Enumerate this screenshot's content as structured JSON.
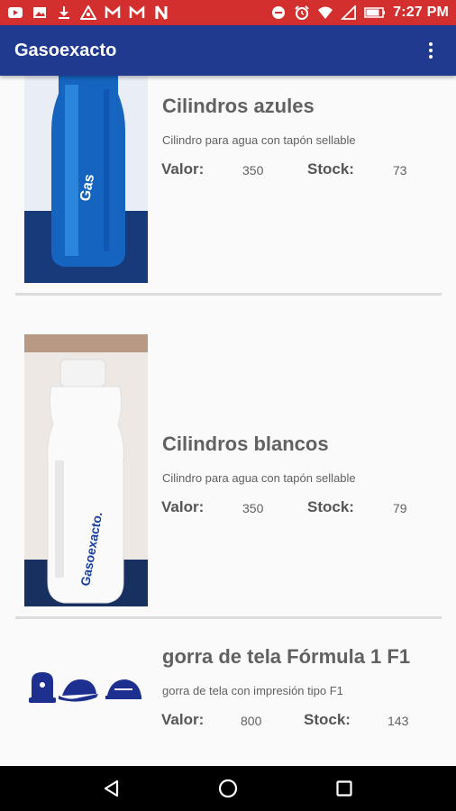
{
  "status_bar": {
    "time": "7:27 PM",
    "left_icons": [
      "youtube-icon",
      "gallery-icon",
      "download-icon",
      "alert-icon",
      "gmail-icon",
      "gmail-icon",
      "netflix-icon"
    ],
    "right_icons": [
      "do-not-disturb-icon",
      "alarm-icon",
      "wifi-icon",
      "signal-icon",
      "battery-icon"
    ]
  },
  "app_bar": {
    "title": "Gasoexacto",
    "menu_icon": "more-vert-icon"
  },
  "products": [
    {
      "title": "Cilindros azules",
      "description": "Cilindro para agua con tapón sellable",
      "value_label": "Valor:",
      "value": "350",
      "stock_label": "Stock:",
      "stock": "73",
      "image": "blue-bottle"
    },
    {
      "title": "Cilindros blancos",
      "description": "Cilindro para agua con tapón sellable",
      "value_label": "Valor:",
      "value": "350",
      "stock_label": "Stock:",
      "stock": "79",
      "image": "white-bottle"
    },
    {
      "title": "gorra de tela Fórmula 1 F1",
      "description": "gorra de tela con impresión tipo F1",
      "value_label": "Valor:",
      "value": "800",
      "stock_label": "Stock:",
      "stock": "143",
      "image": "caps"
    }
  ],
  "nav_bar": {
    "back": "back-icon",
    "home": "home-icon",
    "recents": "recents-icon"
  },
  "colors": {
    "status_bar": "#d32f2f",
    "app_bar": "#1f3a8f",
    "text_gray": "#616161"
  }
}
